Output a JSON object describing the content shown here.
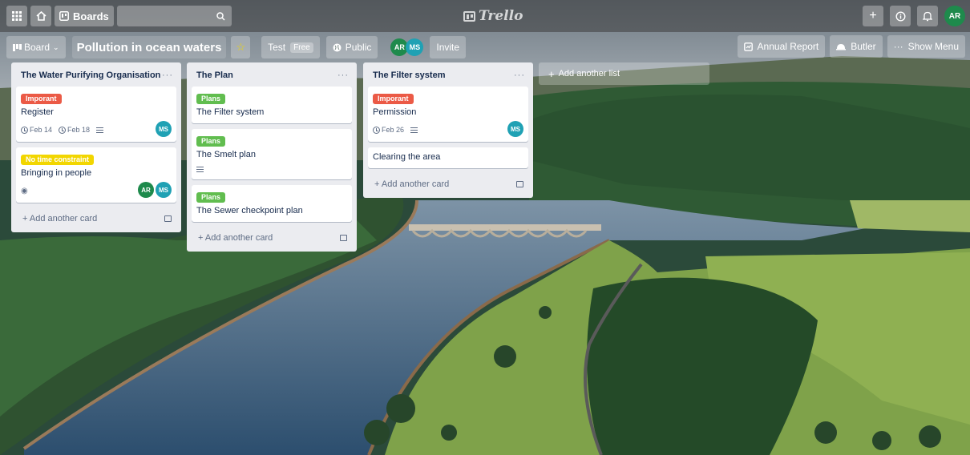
{
  "topbar": {
    "boards_label": "Boards",
    "logo_text": "Trello",
    "user_initials": "AR"
  },
  "board": {
    "view_label": "Board",
    "title": "Pollution in ocean waters",
    "team_label": "Test",
    "team_plan": "Free",
    "visibility_label": "Public",
    "members": [
      "AR",
      "MS"
    ],
    "invite_label": "Invite",
    "annual_report_label": "Annual Report",
    "butler_label": "Butler",
    "show_menu_label": "Show Menu"
  },
  "lists": [
    {
      "title": "The Water Purifying Organisation",
      "cards": [
        {
          "label": "Imporant",
          "label_color": "#eb5a46",
          "title": "Register",
          "dates": [
            "Feb 14",
            "Feb 18"
          ],
          "has_description": true,
          "members": [
            "MS"
          ]
        },
        {
          "label": "No time constraint",
          "label_color": "#f2d600",
          "title": "Bringing in people",
          "watching": true,
          "members": [
            "AR",
            "MS"
          ]
        }
      ],
      "add_card_label": "Add another card"
    },
    {
      "title": "The Plan",
      "cards": [
        {
          "label": "Plans",
          "label_color": "#61bd4f",
          "title": "The Filter system"
        },
        {
          "label": "Plans",
          "label_color": "#61bd4f",
          "title": "The Smelt plan",
          "has_description": true
        },
        {
          "label": "Plans",
          "label_color": "#61bd4f",
          "title": "The Sewer checkpoint plan"
        }
      ],
      "add_card_label": "Add another card"
    },
    {
      "title": "The Filter system",
      "cards": [
        {
          "label": "Imporant",
          "label_color": "#eb5a46",
          "title": "Permission",
          "dates": [
            "Feb 26"
          ],
          "has_description": true,
          "members": [
            "MS"
          ]
        },
        {
          "title": "Clearing the area"
        }
      ],
      "add_card_label": "Add another card"
    }
  ],
  "add_list_label": "Add another list",
  "colors": {
    "member_ar": "#1e8a4c",
    "member_ms": "#1fa1b4",
    "list_bg": "#ebecf0"
  }
}
